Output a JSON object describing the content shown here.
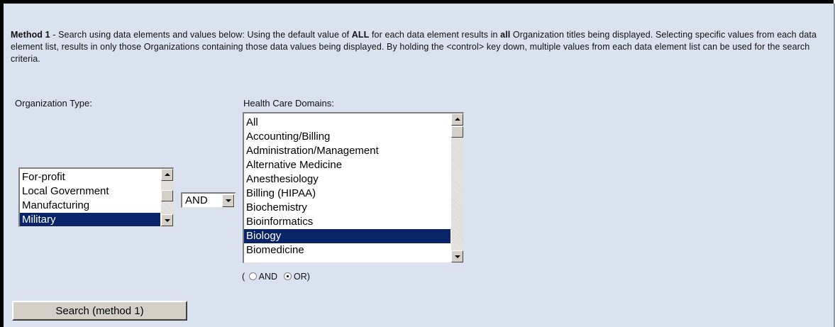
{
  "intro": {
    "method_label": "Method 1",
    "text_1": " - Search using data elements and values below: Using the default value of ",
    "all_caps": "ALL",
    "text_2": " for each data element results in ",
    "all_lower": "all",
    "text_3": " Organization titles being displayed. Selecting specific values from each data element list, results in only those Organizations containing those data values being displayed. By holding the <control> key down, multiple values from each data element list can be used for the search criteria."
  },
  "org_type": {
    "label": "Organization Type:",
    "options": [
      "For-profit",
      "Local Government",
      "Manufacturing",
      "Military"
    ],
    "selected": "Military"
  },
  "operator_select": {
    "value": "AND"
  },
  "domains": {
    "label": "Health Care Domains:",
    "options": [
      "All",
      "Accounting/Billing",
      "Administration/Management",
      "Alternative Medicine",
      "Anesthesiology",
      "Billing (HIPAA)",
      "Biochemistry",
      "Bioinformatics",
      "Biology",
      "Biomedicine"
    ],
    "selected": "Biology"
  },
  "radio_group": {
    "open": "(",
    "and_label": "AND",
    "or_label": "OR)",
    "selected": "OR"
  },
  "search_button": {
    "label": "Search (method 1)"
  }
}
